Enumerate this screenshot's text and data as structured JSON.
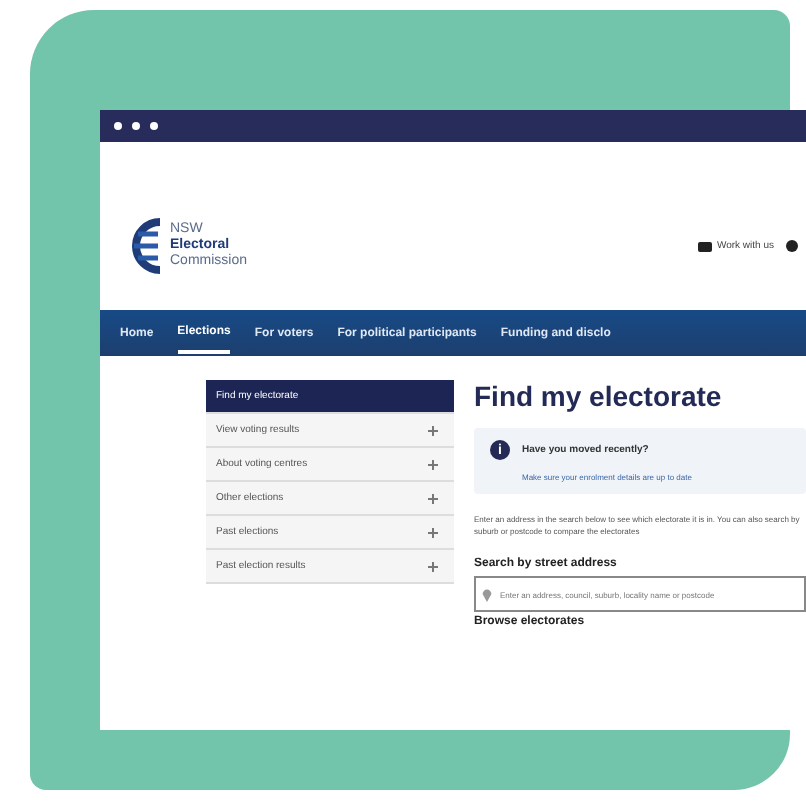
{
  "header": {
    "logo_lines": [
      "NSW",
      "Electoral",
      "Commission"
    ],
    "utility_links": [
      "Work with us"
    ]
  },
  "nav": [
    {
      "label": "Home",
      "selected": false
    },
    {
      "label": "Elections",
      "selected": true
    },
    {
      "label": "For voters",
      "selected": false
    },
    {
      "label": "For political participants",
      "selected": false
    },
    {
      "label": "Funding and disclo",
      "selected": false
    }
  ],
  "sidebar": {
    "items": [
      {
        "label": "Find my electorate",
        "selected": true,
        "expandable": false
      },
      {
        "label": "View voting results",
        "selected": false,
        "expandable": true
      },
      {
        "label": "About voting centres",
        "selected": false,
        "expandable": true
      },
      {
        "label": "Other elections",
        "selected": false,
        "expandable": true
      },
      {
        "label": "Past elections",
        "selected": false,
        "expandable": true
      },
      {
        "label": "Past election results",
        "selected": false,
        "expandable": true
      }
    ]
  },
  "main": {
    "title": "Find my electorate",
    "notice": {
      "icon": "i",
      "title": "Have you moved recently?",
      "link": "Make sure your enrolment details are up to date"
    },
    "intro": "Enter an address in the search below to see which electorate it is in. You can also search by suburb or postcode to compare the electorates",
    "search": {
      "label": "Search by street address",
      "placeholder": "Enter an address, council, suburb, locality name or postcode"
    },
    "browse": "Browse electorates"
  }
}
